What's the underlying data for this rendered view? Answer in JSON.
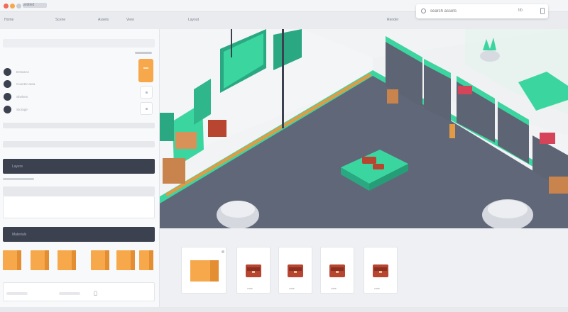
{
  "window": {
    "title": "untitled",
    "controls": [
      "close",
      "minimize",
      "maximize"
    ]
  },
  "topnav": {
    "items": [
      "Home",
      "Scene",
      "Assets",
      "View",
      "Layout",
      "Render"
    ]
  },
  "search": {
    "value": "",
    "placeholder": "search assets",
    "extension": "lib"
  },
  "sidebar": {
    "items": [
      {
        "label": "Entrance"
      },
      {
        "label": "Counter area"
      },
      {
        "label": "Shelves"
      },
      {
        "label": "Storage"
      }
    ],
    "section_1": "Layers",
    "section_2": "Materials"
  },
  "assets": {
    "items": [
      {
        "caption": "folder"
      },
      {
        "caption": "crate"
      },
      {
        "caption": "crate"
      },
      {
        "caption": "crate"
      },
      {
        "caption": "crate"
      }
    ]
  },
  "colors": {
    "accent_orange": "#f6a84a",
    "accent_teal": "#3bd6a0",
    "floor": "#606778",
    "panel_dark": "#3c4150"
  }
}
